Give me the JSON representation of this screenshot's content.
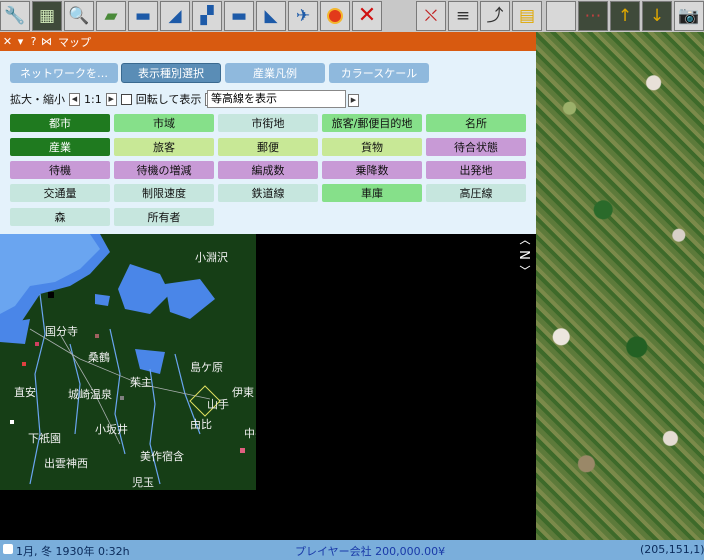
{
  "window": {
    "title": "マップ"
  },
  "toolbar": {
    "buttons": [
      {
        "name": "settings",
        "glyph": "🔧"
      },
      {
        "name": "minimap",
        "glyph": "▦"
      },
      {
        "name": "search",
        "glyph": "🔍"
      },
      {
        "name": "terrain",
        "glyph": "▰"
      },
      {
        "name": "rail",
        "glyph": "▬"
      },
      {
        "name": "road",
        "glyph": "◢"
      },
      {
        "name": "tram",
        "glyph": "▞"
      },
      {
        "name": "truck",
        "glyph": "▬"
      },
      {
        "name": "ship",
        "glyph": "◣"
      },
      {
        "name": "air",
        "glyph": "✈"
      },
      {
        "name": "special",
        "glyph": "●"
      },
      {
        "name": "remove",
        "glyph": "✕"
      },
      {
        "name": "line-management",
        "glyph": "⛌"
      },
      {
        "name": "list",
        "glyph": "≡"
      },
      {
        "name": "finance",
        "glyph": "⤴"
      },
      {
        "name": "chart",
        "glyph": "▤"
      },
      {
        "name": "blank",
        "glyph": ""
      },
      {
        "name": "signal",
        "glyph": "⋯"
      },
      {
        "name": "slope-up",
        "glyph": "↑"
      },
      {
        "name": "slope-down",
        "glyph": "↓"
      },
      {
        "name": "screenshot",
        "glyph": "📷"
      }
    ]
  },
  "panel": {
    "top_buttons": [
      "ネットワークを…",
      "表示種別選択",
      "産業凡例",
      "カラースケール"
    ],
    "zoom_label": "拡大・縮小",
    "zoom_value": "1:1",
    "rotate_label": "回転して表示",
    "layer_select_value": "等高線を表示",
    "layers": [
      [
        "都市",
        "市域",
        "市街地",
        "旅客/郵便目的地",
        "名所"
      ],
      [
        "産業",
        "旅客",
        "郵便",
        "貨物",
        "待合状態"
      ],
      [
        "待機",
        "待機の増減",
        "編成数",
        "乗降数",
        "出発地"
      ],
      [
        "交通量",
        "制限速度",
        "鉄道線",
        "車庫",
        "高圧線"
      ],
      [
        "森",
        "所有者"
      ]
    ]
  },
  "minimap": {
    "cities": [
      "小淵沢",
      "国分寺",
      "桑鶴",
      "島ケ原",
      "茱主",
      "伊東",
      "直安",
      "城崎温泉",
      "山手",
      "由比",
      "小坂井",
      "下祇園",
      "中井侍",
      "出雲神西",
      "美作宿含",
      "児玉"
    ]
  },
  "status": {
    "date": "1月, 冬 1930年  0:32h",
    "company": "プレイヤー会社 200,000.00¥",
    "coords": "(205,151,1)"
  }
}
